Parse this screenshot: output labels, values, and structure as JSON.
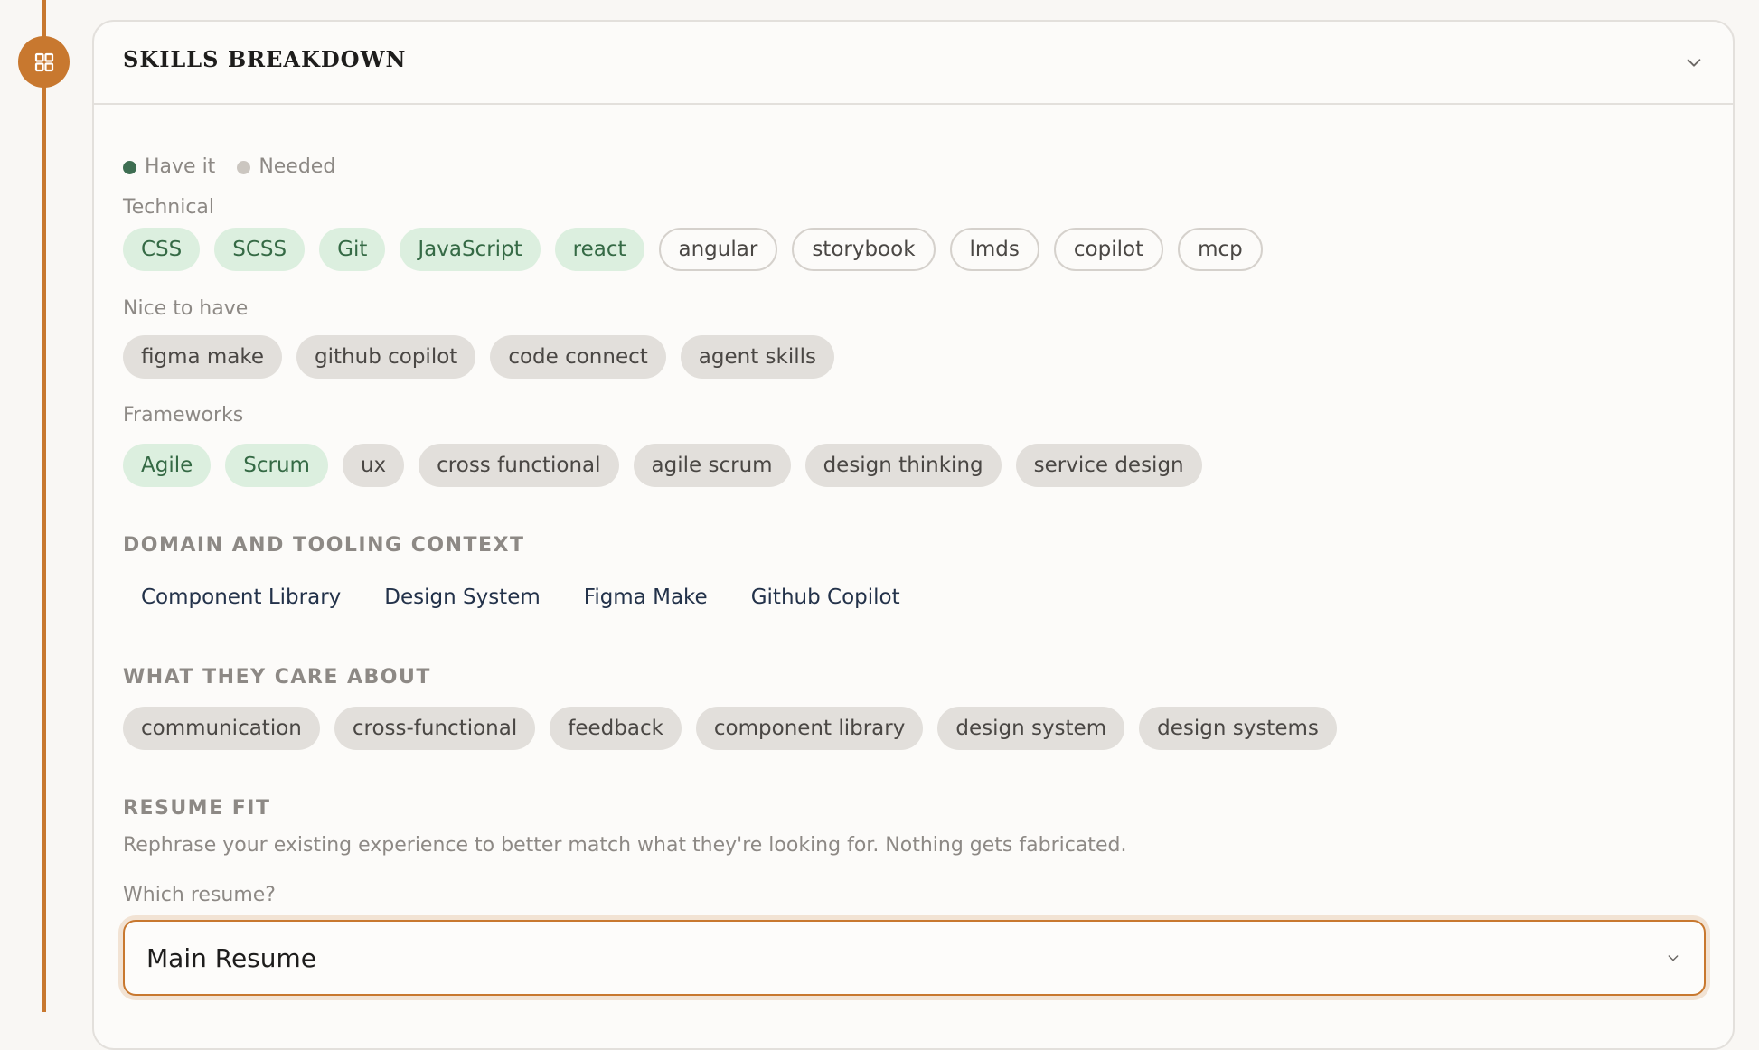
{
  "card": {
    "title": "SKILLS BREAKDOWN"
  },
  "legend": {
    "have_label": "Have it",
    "have_color": "#3e6e52",
    "needed_label": "Needed",
    "needed_color": "#cbc6c0"
  },
  "technical": {
    "label": "Technical",
    "tags": [
      {
        "text": "CSS",
        "status": "have"
      },
      {
        "text": "SCSS",
        "status": "have"
      },
      {
        "text": "Git",
        "status": "have"
      },
      {
        "text": "JavaScript",
        "status": "have"
      },
      {
        "text": "react",
        "status": "have"
      },
      {
        "text": "angular",
        "status": "needed"
      },
      {
        "text": "storybook",
        "status": "needed"
      },
      {
        "text": "lmds",
        "status": "needed"
      },
      {
        "text": "copilot",
        "status": "needed"
      },
      {
        "text": "mcp",
        "status": "needed"
      }
    ]
  },
  "nice_to_have": {
    "label": "Nice to have",
    "tags": [
      {
        "text": "figma make"
      },
      {
        "text": "github copilot"
      },
      {
        "text": "code connect"
      },
      {
        "text": "agent skills"
      }
    ]
  },
  "frameworks": {
    "label": "Frameworks",
    "tags": [
      {
        "text": "Agile",
        "status": "have"
      },
      {
        "text": "Scrum",
        "status": "have"
      },
      {
        "text": "ux",
        "status": "plain"
      },
      {
        "text": "cross functional",
        "status": "plain"
      },
      {
        "text": "agile scrum",
        "status": "plain"
      },
      {
        "text": "design thinking",
        "status": "plain"
      },
      {
        "text": "service design",
        "status": "plain"
      }
    ]
  },
  "domain_context": {
    "heading": "DOMAIN AND TOOLING CONTEXT",
    "items": [
      "Component Library",
      "Design System",
      "Figma Make",
      "Github Copilot"
    ]
  },
  "care_about": {
    "heading": "WHAT THEY CARE ABOUT",
    "tags": [
      "communication",
      "cross-functional",
      "feedback",
      "component library",
      "design system",
      "design systems"
    ]
  },
  "resume_fit": {
    "heading": "RESUME FIT",
    "description": "Rephrase your existing experience to better match what they're looking for. Nothing gets fabricated.",
    "select_label": "Which resume?",
    "selected": "Main Resume"
  },
  "icons": {
    "timeline": "grid-icon",
    "collapse": "chevron-down-icon",
    "select": "chevron-down-icon"
  },
  "colors": {
    "accent": "#c8782f",
    "have_bg": "#dcefdf",
    "have_text": "#356a45",
    "plain_bg": "#e2dfdb"
  }
}
